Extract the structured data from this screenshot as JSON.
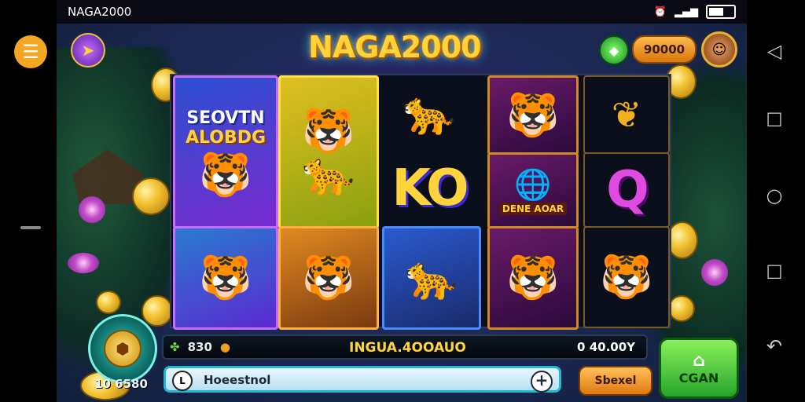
{
  "status_bar": {
    "app_name": "NAGA2000",
    "icons": [
      "alarm-icon",
      "signal-icon",
      "battery-icon"
    ]
  },
  "header": {
    "title": "NAGA2000",
    "balance": "90000"
  },
  "reels": {
    "reel1": {
      "logo_line1": "SEOVTN",
      "logo_line2": "ALOBDG"
    },
    "reel3": {
      "letter": "KO"
    },
    "reel4": {
      "badge": "DENE AOAR"
    },
    "reel5": {
      "letter": "Q"
    }
  },
  "spin": {
    "total": "10 6580"
  },
  "info_bar": {
    "credits": "830",
    "label": "INGUA.4OOAUO",
    "win": "0 40.00Y"
  },
  "input": {
    "text": "Hoeestnol",
    "icon_label": "L"
  },
  "buttons": {
    "orange_label": "Sbexel",
    "green_label": "CGAN"
  },
  "nav": [
    "back-icon",
    "recents-icon",
    "home-icon",
    "overview-icon",
    "return-icon"
  ],
  "colors": {
    "title": "#ffd43a",
    "accent_teal": "#1fb8d8",
    "green_button": "#26a52a",
    "orange_button": "#e07a10"
  }
}
